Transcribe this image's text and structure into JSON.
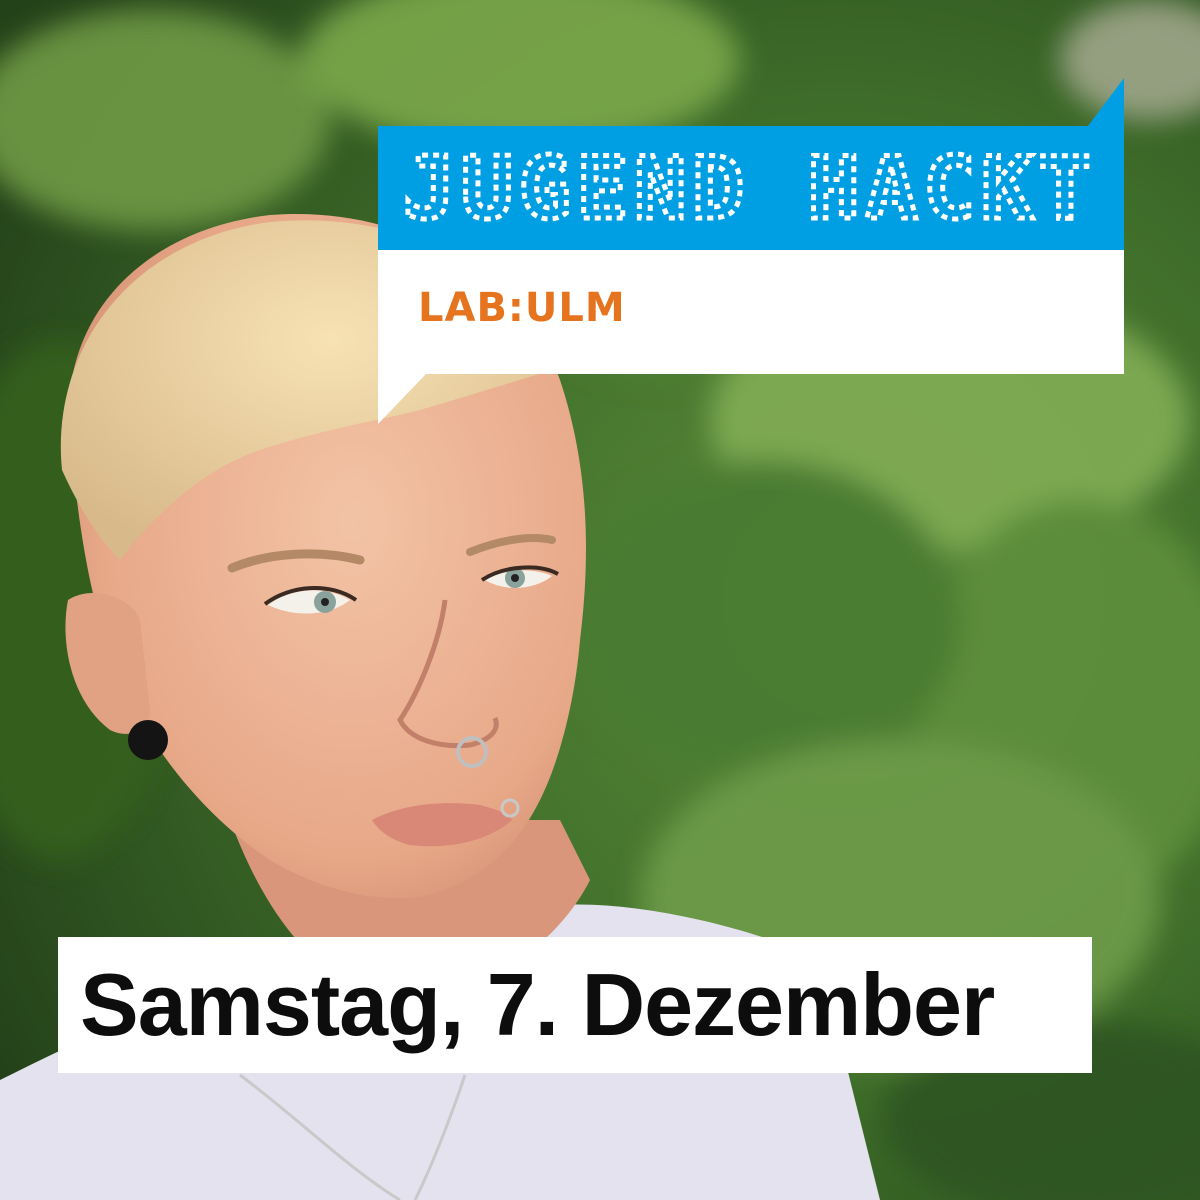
{
  "logo": {
    "title": "JUGEND HACKT",
    "subtitle": "LAB:ULM",
    "accent_color": "#009fe3",
    "subtitle_color": "#e6731e"
  },
  "event": {
    "date": "Samstag, 7. Dezember"
  }
}
